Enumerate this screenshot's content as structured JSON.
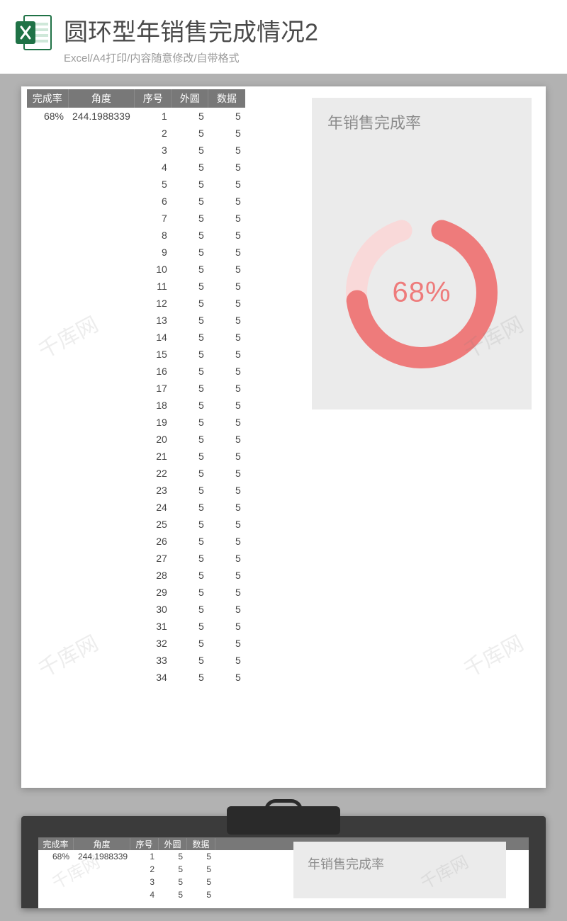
{
  "header": {
    "title": "圆环型年销售完成情况2",
    "subtitle": "Excel/A4打印/内容随意修改/自带格式"
  },
  "table": {
    "headers": [
      "完成率",
      "角度",
      "序号",
      "外圆",
      "数据"
    ],
    "completion_rate": "68%",
    "angle": "244.1988339",
    "row_count": 34,
    "outer_circle_value": "5",
    "data_value": "5"
  },
  "chart_data": {
    "type": "pie",
    "title": "年销售完成率",
    "center_label": "68%",
    "completion_pct": 68,
    "sweep_deg": 244.8,
    "colors": {
      "arc": "#ee7b7b",
      "track": "#f9d9d9",
      "center_text": "#ee7b7b",
      "card_bg": "#ebebeb"
    }
  },
  "watermark": "千库网",
  "thumbnail": {
    "chart_title_overlay": "年销售完成率"
  }
}
